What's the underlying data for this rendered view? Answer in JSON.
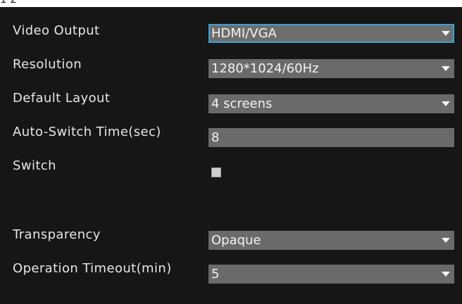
{
  "header_fragment": "1 2",
  "settings": {
    "video_output": {
      "label": "Video Output",
      "value": "HDMI/VGA"
    },
    "resolution": {
      "label": "Resolution",
      "value": "1280*1024/60Hz"
    },
    "default_layout": {
      "label": "Default Layout",
      "value": "4 screens"
    },
    "auto_switch_time": {
      "label": "Auto-Switch Time(sec)",
      "value": "8"
    },
    "switch": {
      "label": "Switch",
      "checked": false
    },
    "transparency": {
      "label": "Transparency",
      "value": "Opaque"
    },
    "operation_timeout": {
      "label": "Operation Timeout(min)",
      "value": "5"
    }
  },
  "colors": {
    "panel_background": "#161616",
    "field_background": "#6a6a6a",
    "focus_border": "#3aa0d4",
    "label_text": "#e6e6e6"
  },
  "icons": {
    "dropdown": "chevron-down-icon"
  }
}
